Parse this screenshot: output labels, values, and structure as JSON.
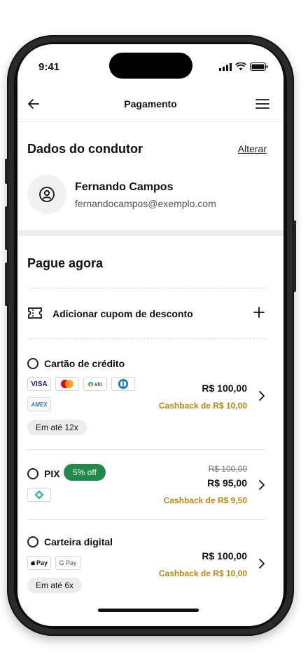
{
  "status_bar": {
    "time": "9:41"
  },
  "header": {
    "title": "Pagamento"
  },
  "driver_section": {
    "title": "Dados do condutor",
    "change_link": "Alterar",
    "name": "Fernando Campos",
    "email": "fernandocampos@exemplo.com"
  },
  "pay_section": {
    "title": "Pague agora"
  },
  "coupon": {
    "label": "Adicionar cupom de desconto"
  },
  "methods": [
    {
      "label": "Cartão de crédito",
      "logos": [
        "VISA",
        "mastercard",
        "elo",
        "diners",
        "AMEX"
      ],
      "price": "R$ 100,00",
      "cashback": "Cashback de R$ 10,00",
      "installments": "Em até 12x"
    },
    {
      "label": "PIX",
      "badge": "5% off",
      "logos": [
        "pix"
      ],
      "old_price": "R$ 100,00",
      "price": "R$ 95,00",
      "cashback": "Cashback de R$ 9,50"
    },
    {
      "label": "Carteira digital",
      "logos": [
        "Pay",
        "G Pay"
      ],
      "price": "R$ 100,00",
      "cashback": "Cashback de R$ 10,00",
      "installments": "Em até 6x"
    }
  ],
  "colors": {
    "accent_green": "#1f8a4c",
    "cashback": "#b8860b"
  }
}
